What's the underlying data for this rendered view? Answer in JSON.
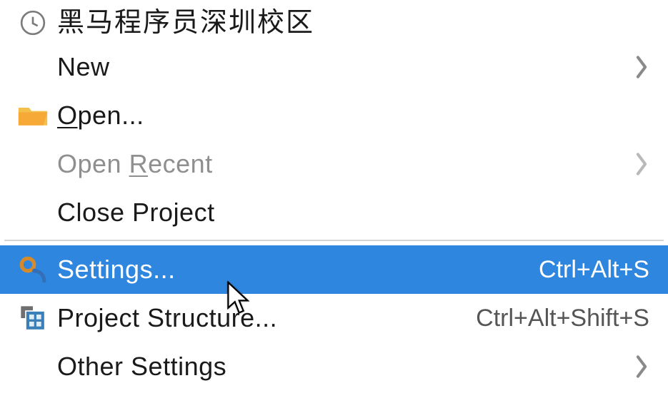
{
  "menu": {
    "items": [
      {
        "id": "recent-project",
        "label": "黑马程序员深圳校区",
        "icon": "clock-icon",
        "shortcut": "",
        "submenu": false,
        "disabled": false
      },
      {
        "id": "new",
        "label": "New",
        "icon": "",
        "shortcut": "",
        "submenu": true,
        "disabled": false
      },
      {
        "id": "open",
        "label_pre": "",
        "mn": "O",
        "label_post": "pen...",
        "icon": "folder-icon",
        "shortcut": "",
        "submenu": false,
        "disabled": false
      },
      {
        "id": "open-recent",
        "label_pre": "Open ",
        "mn": "R",
        "label_post": "ecent",
        "icon": "",
        "shortcut": "",
        "submenu": true,
        "disabled": true
      },
      {
        "id": "close-project",
        "label": "Close Project",
        "icon": "",
        "shortcut": "",
        "submenu": false,
        "disabled": false
      },
      {
        "id": "settings",
        "label": "Settings...",
        "icon": "settings-icon",
        "shortcut": "Ctrl+Alt+S",
        "submenu": false,
        "disabled": false,
        "selected": true
      },
      {
        "id": "project-structure",
        "label": "Project Structure...",
        "icon": "project-structure-icon",
        "shortcut": "Ctrl+Alt+Shift+S",
        "submenu": false,
        "disabled": false
      },
      {
        "id": "other-settings",
        "label": "Other Settings",
        "icon": "",
        "shortcut": "",
        "submenu": true,
        "disabled": false
      }
    ]
  },
  "colors": {
    "selection": "#2f86de"
  }
}
